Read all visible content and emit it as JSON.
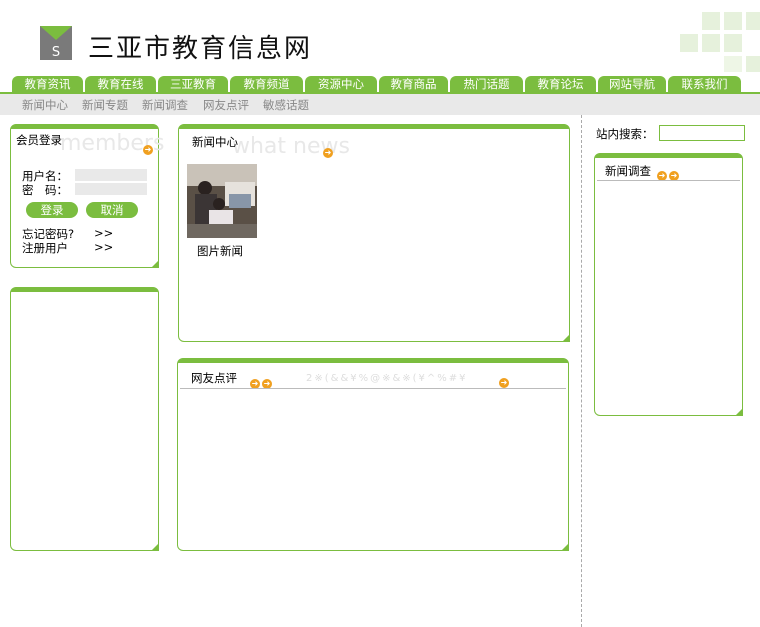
{
  "header": {
    "title": "三亚市教育信息网",
    "logo_letter": "S",
    "logo_icon": "site-logo-icon"
  },
  "nav": {
    "tabs": [
      "教育资讯",
      "教育在线",
      "三亚教育",
      "教育频道",
      "资源中心",
      "教育商品",
      "热门话题",
      "教育论坛",
      "网站导航",
      "联系我们"
    ]
  },
  "subnav": {
    "items": [
      "新闻中心",
      "新闻专题",
      "新闻调查",
      "网友点评",
      "敏感话题"
    ]
  },
  "login": {
    "title": "会员登录",
    "ghost": "members",
    "username_label": "用户名：",
    "password_label": "密　码：",
    "login_button": "登录",
    "cancel_button": "取消",
    "forgot_label": "忘记密码?",
    "register_label": "注册用户",
    "chevron": ">>"
  },
  "news_center": {
    "title": "新闻中心",
    "ghost": "what news",
    "photo_caption": "图片新闻"
  },
  "comments": {
    "title": "网友点评",
    "garbled": "2※(&&¥%@※&※(¥^%#¥"
  },
  "search": {
    "label": "站内搜索："
  },
  "survey": {
    "title": "新闻调查"
  },
  "colors": {
    "accent_green": "#7bbd3f",
    "arrow_orange": "#f0a020",
    "subnav_bg": "#e9e9e9"
  }
}
